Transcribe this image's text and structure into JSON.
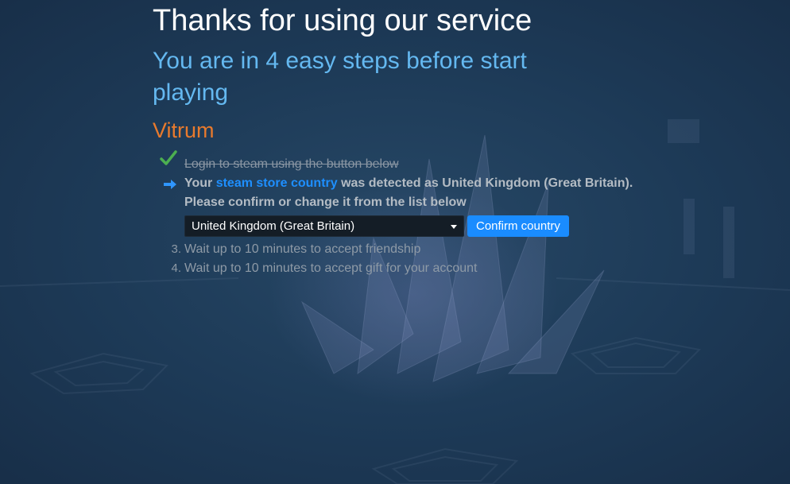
{
  "header": {
    "title": "Thanks for using our service",
    "subtitle": "You are in 4 easy steps before start playing",
    "game_name": "Vitrum"
  },
  "steps": [
    {
      "number": "",
      "status": "done",
      "icon": "check-icon",
      "text": "Login to steam using the button below"
    },
    {
      "number": "",
      "status": "current",
      "icon": "arrow-right-icon",
      "text_before": "Your ",
      "link_text": "steam store country",
      "text_after": " was detected as United Kingdom (Great Britain).",
      "line2": "Please confirm or change it from the list below"
    },
    {
      "number": "3.",
      "status": "pending",
      "text": "Wait up to 10 minutes to accept friendship"
    },
    {
      "number": "4.",
      "status": "pending",
      "text": "Wait up to 10 minutes to accept gift for your account"
    }
  ],
  "country_select": {
    "selected": "United Kingdom (Great Britain)"
  },
  "confirm_button": {
    "label": "Confirm country"
  },
  "colors": {
    "accent": "#1a8cff",
    "subtitle": "#64b8f0",
    "game_name": "#e87a2d",
    "check": "#4caf50",
    "background": "#1b3350"
  }
}
